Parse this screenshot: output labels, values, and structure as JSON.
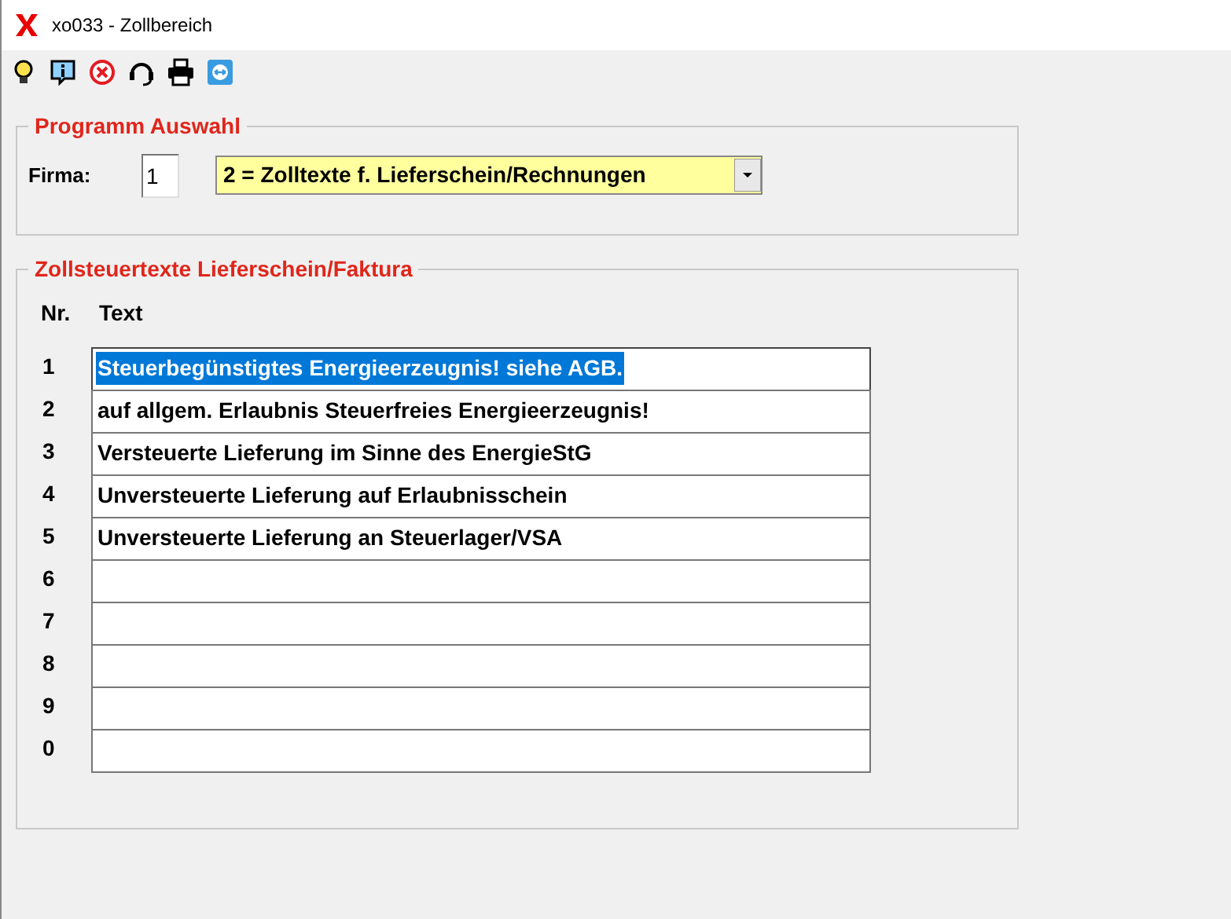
{
  "window": {
    "title": "xo033 - Zollbereich"
  },
  "toolbar": {
    "icons": [
      {
        "kind": "bulb"
      },
      {
        "kind": "info"
      },
      {
        "kind": "cancel"
      },
      {
        "kind": "headset"
      },
      {
        "kind": "print"
      },
      {
        "kind": "remote"
      }
    ]
  },
  "program_selection": {
    "title": "Programm Auswahl",
    "firma_label": "Firma:",
    "firma_value": "1",
    "program_value": "2 = Zolltexte f. Lieferschein/Rechnungen"
  },
  "texts": {
    "title": "Zollsteuertexte Lieferschein/Faktura",
    "columns": [
      "Nr.",
      "Text"
    ],
    "rows": [
      {
        "nr": "1",
        "text": "Steuerbegünstigtes Energieerzeugnis! siehe AGB.",
        "selected": true
      },
      {
        "nr": "2",
        "text": "auf allgem. Erlaubnis Steuerfreies Energieerzeugnis!",
        "selected": false
      },
      {
        "nr": "3",
        "text": "Versteuerte Lieferung im Sinne des EnergieStG",
        "selected": false
      },
      {
        "nr": "4",
        "text": "Unversteuerte Lieferung auf Erlaubnisschein",
        "selected": false
      },
      {
        "nr": "5",
        "text": "Unversteuerte Lieferung an Steuerlager/VSA",
        "selected": false
      },
      {
        "nr": "6",
        "selected": false
      },
      {
        "nr": "7",
        "selected": false
      },
      {
        "nr": "8",
        "selected": false
      },
      {
        "nr": "9",
        "selected": false
      },
      {
        "nr": "0",
        "selected": false
      }
    ]
  }
}
